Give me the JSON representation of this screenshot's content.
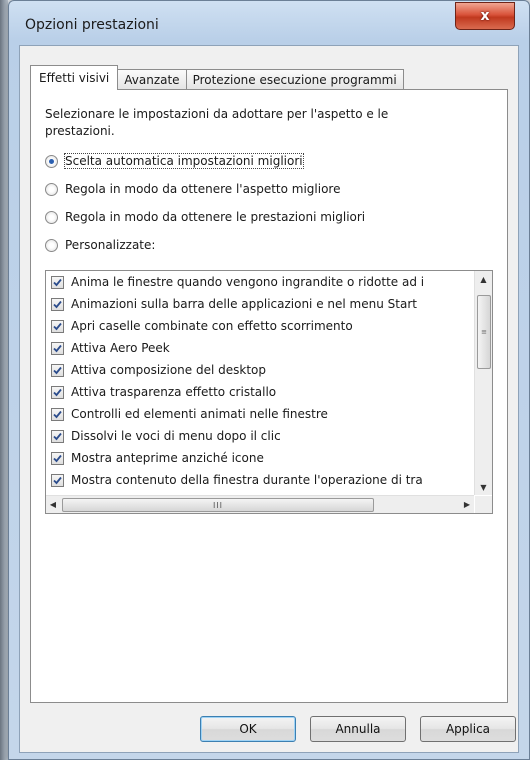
{
  "window": {
    "title": "Opzioni prestazioni",
    "close_label": "x"
  },
  "tabs": [
    {
      "label": "Effetti visivi",
      "active": true
    },
    {
      "label": "Avanzate",
      "active": false
    },
    {
      "label": "Protezione esecuzione programmi",
      "active": false
    }
  ],
  "panel": {
    "description": "Selezionare le impostazioni da adottare per l'aspetto e le prestazioni.",
    "options": [
      {
        "label": "Scelta automatica impostazioni migliori",
        "checked": true
      },
      {
        "label": "Regola in modo da ottenere l'aspetto migliore",
        "checked": false
      },
      {
        "label": "Regola in modo da ottenere le prestazioni migliori",
        "checked": false
      },
      {
        "label": "Personalizzate:",
        "checked": false
      }
    ],
    "effects": [
      {
        "label": "Anima le finestre quando vengono ingrandite o ridotte ad i",
        "checked": true
      },
      {
        "label": "Animazioni sulla barra delle applicazioni e nel menu Start",
        "checked": true
      },
      {
        "label": "Apri caselle combinate con effetto scorrimento",
        "checked": true
      },
      {
        "label": "Attiva Aero Peek",
        "checked": true
      },
      {
        "label": "Attiva composizione del desktop",
        "checked": true
      },
      {
        "label": "Attiva trasparenza effetto cristallo",
        "checked": true
      },
      {
        "label": "Controlli ed elementi animati nelle finestre",
        "checked": true
      },
      {
        "label": "Dissolvi le voci di menu dopo il clic",
        "checked": true
      },
      {
        "label": "Mostra anteprime anziché icone",
        "checked": true
      },
      {
        "label": "Mostra contenuto della finestra durante l'operazione di tra",
        "checked": true
      }
    ],
    "scrollbar": {
      "h_grip": "III",
      "v_grip": "≡"
    }
  },
  "buttons": {
    "ok": "OK",
    "cancel": "Annulla",
    "apply": "Applica"
  },
  "colors": {
    "accent": "#2a5fb0",
    "close": "#c0391f",
    "window_frame": "#b9cfe8"
  }
}
